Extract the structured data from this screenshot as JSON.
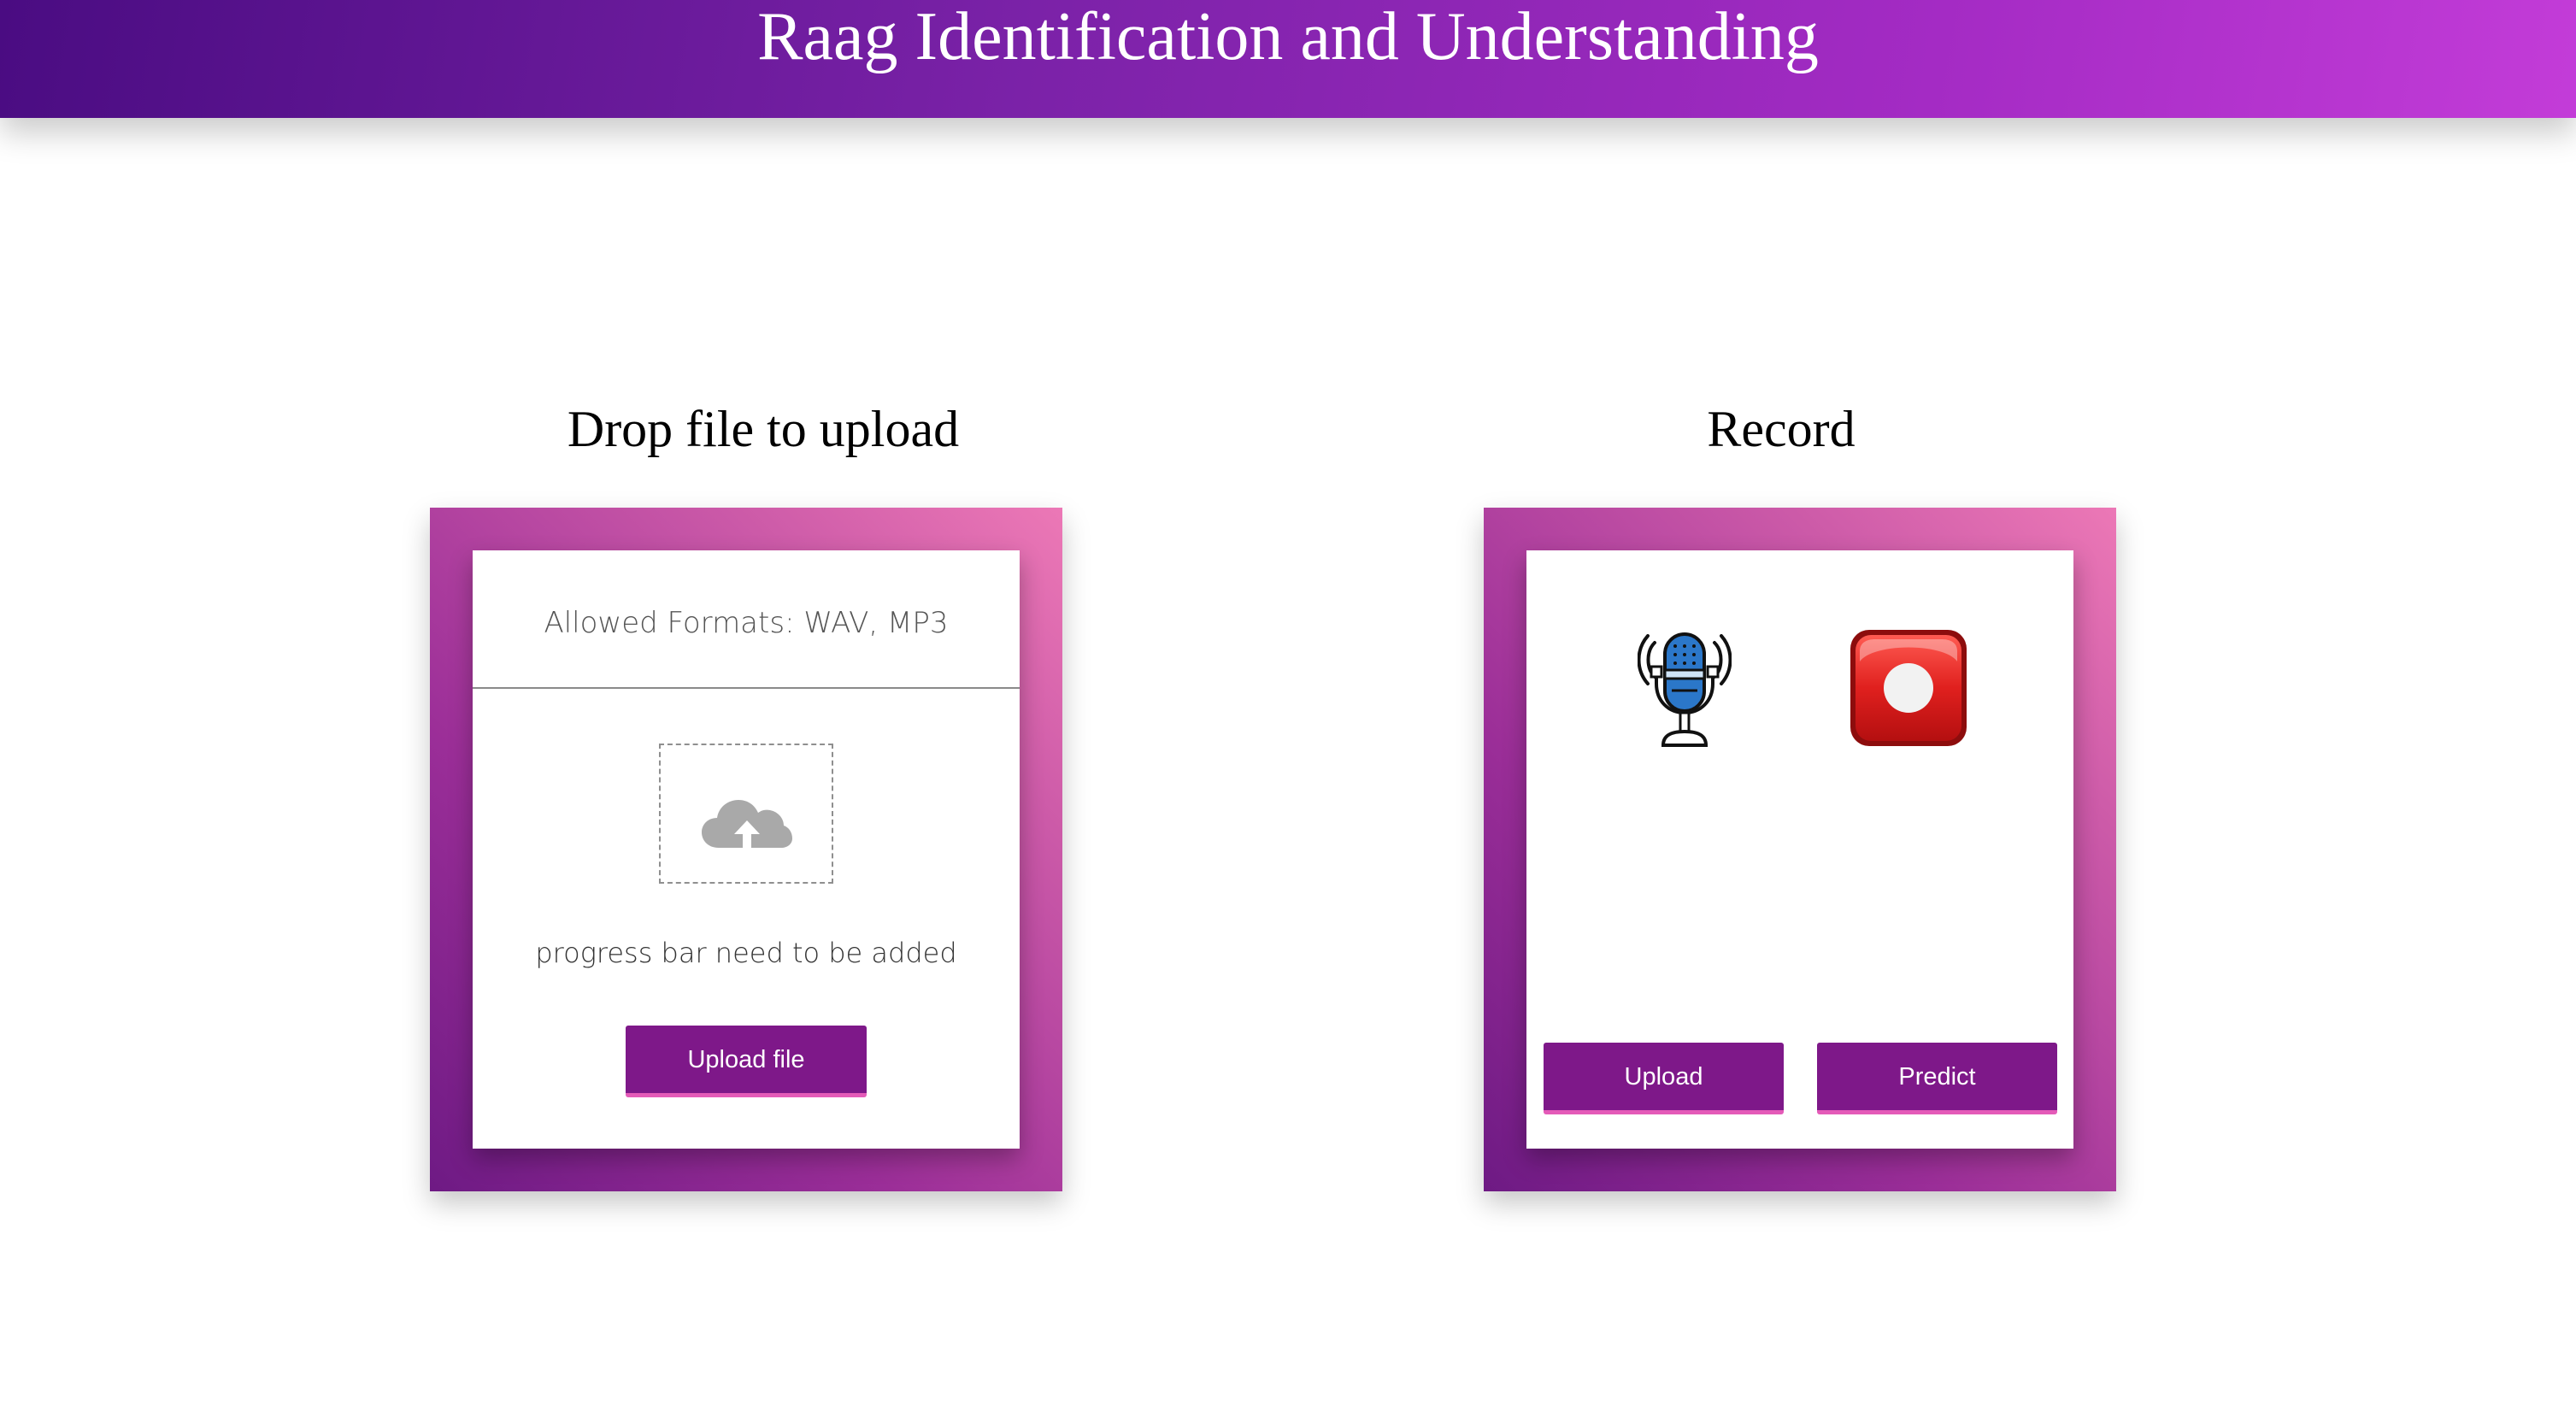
{
  "header": {
    "title": "Raag Identification and Understanding"
  },
  "upload_section": {
    "title": "Drop file to upload",
    "allowed_formats": "Allowed Formats: WAV, MP3",
    "dropzone_icon": "cloud-upload-icon",
    "progress_note": "progress bar need to be added",
    "upload_button": "Upload file"
  },
  "record_section": {
    "title": "Record",
    "mic_icon": "microphone-icon",
    "record_icon": "record-button-icon",
    "upload_button": "Upload",
    "predict_button": "Predict"
  },
  "colors": {
    "header_gradient": [
      "#4a0c82",
      "#c33cd8"
    ],
    "panel_gradient": [
      "#6e1a84",
      "#ec78b6"
    ],
    "button_bg": "#7e1889",
    "button_accent": "#e45bb8",
    "record_red": "#e0201e"
  }
}
